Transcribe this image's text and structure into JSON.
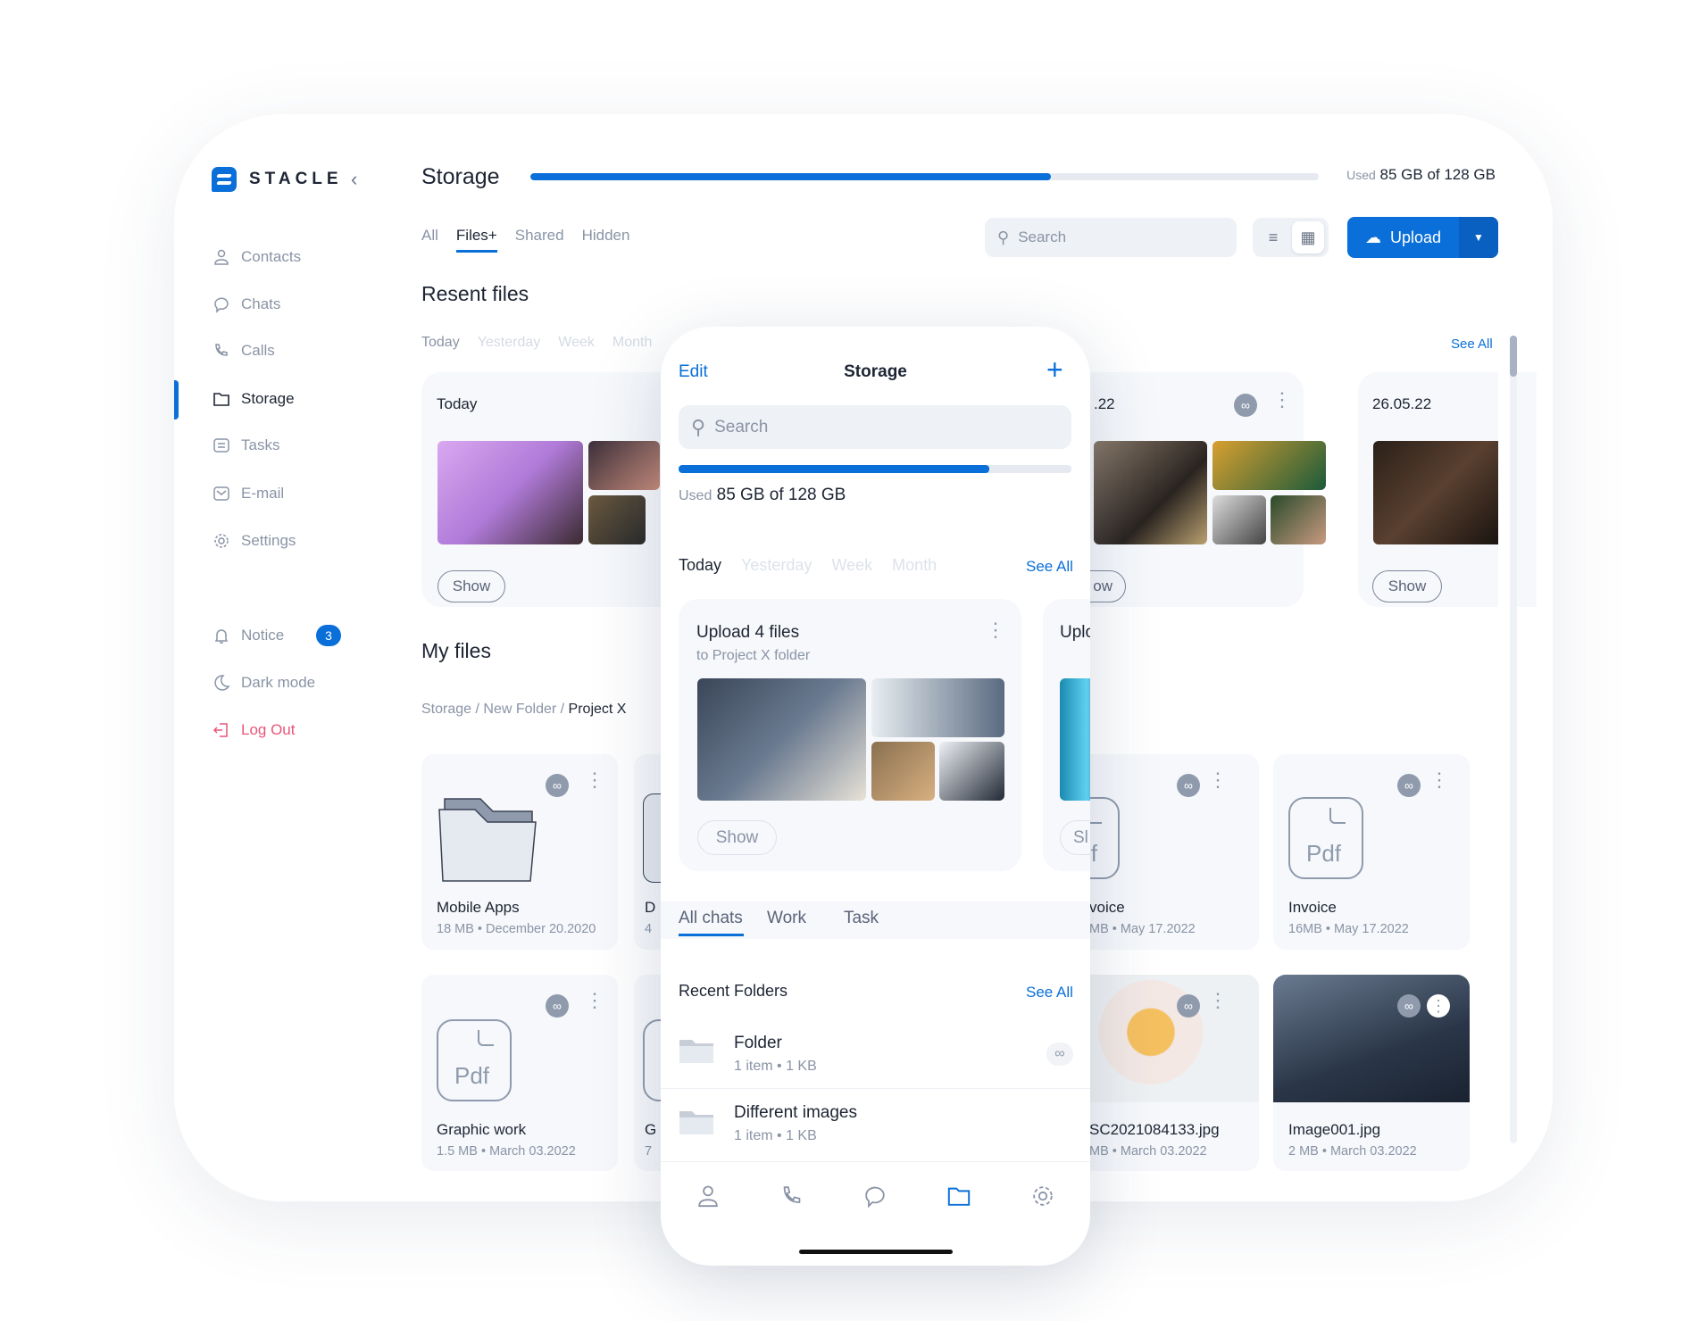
{
  "app": {
    "brand": "STACLE"
  },
  "sidebar": {
    "items": [
      {
        "label": "Contacts",
        "icon": "user-icon"
      },
      {
        "label": "Chats",
        "icon": "chat-icon"
      },
      {
        "label": "Calls",
        "icon": "phone-icon"
      },
      {
        "label": "Storage",
        "icon": "folder-cloud-icon",
        "active": true
      },
      {
        "label": "Tasks",
        "icon": "tasks-icon"
      },
      {
        "label": "E-mail",
        "icon": "mail-icon"
      },
      {
        "label": "Settings",
        "icon": "gear-icon"
      }
    ],
    "notice": {
      "label": "Notice",
      "count": "3"
    },
    "dark_mode": "Dark mode",
    "logout": "Log Out"
  },
  "header": {
    "title": "Storage",
    "used_label": "Used",
    "used_value": "85 GB of 128 GB",
    "progress_percent": 66
  },
  "tabs": [
    "All",
    "Files+",
    "Shared",
    "Hidden"
  ],
  "toolbar": {
    "search_placeholder": "Search",
    "upload": "Upload"
  },
  "recent": {
    "title": "Resent files",
    "periods": [
      "Today",
      "Yesterday",
      "Week",
      "Month"
    ],
    "see_all": "See All",
    "cards": [
      {
        "date": "Today",
        "show": "Show"
      },
      {
        "date": ".22",
        "show": "ow"
      },
      {
        "date": "26.05.22",
        "show": "Show"
      }
    ]
  },
  "myfiles": {
    "title": "My files",
    "breadcrumb": [
      "Storage",
      "New Folder",
      "Project X"
    ],
    "files": [
      {
        "name": "Mobile Apps",
        "meta": "18 MB • December 20.2020",
        "type": "folder"
      },
      {
        "name": "D",
        "meta": "4",
        "type": "folder"
      },
      {
        "name": "voice",
        "meta": "MB • May 17.2022",
        "type": "pdf"
      },
      {
        "name": "Invoice",
        "meta": "16MB • May 17.2022",
        "type": "pdf"
      },
      {
        "name": "Graphic work",
        "meta": "1.5 MB • March 03.2022",
        "type": "pdf"
      },
      {
        "name": "G",
        "meta": "7",
        "type": "pdf"
      },
      {
        "name": "SC2021084133.jpg",
        "meta": "MB • March 03.2022",
        "type": "image"
      },
      {
        "name": "Image001.jpg",
        "meta": "2 MB • March 03.2022",
        "type": "image"
      }
    ],
    "pdf_label": "Pdf"
  },
  "phone": {
    "edit": "Edit",
    "title": "Storage",
    "search_placeholder": "Search",
    "used_label": "Used",
    "used_value": "85 GB of 128 GB",
    "progress_percent": 79,
    "periods": [
      "Today",
      "Yesterday",
      "Week",
      "Month"
    ],
    "see_all": "See All",
    "upload_card": {
      "title": "Upload 4 files",
      "subtitle": "to Project X folder",
      "show": "Show"
    },
    "upload_card2": {
      "title": "Uplo",
      "show": "Sl"
    },
    "chat_tabs": [
      "All chats",
      "Work",
      "Task"
    ],
    "recent_folders": {
      "title": "Recent Folders",
      "see_all": "See All",
      "items": [
        {
          "name": "Folder",
          "meta": "1 item • 1 KB"
        },
        {
          "name": "Different images",
          "meta": "1 item • 1 KB"
        }
      ]
    },
    "bottom_nav": [
      "user-icon",
      "phone-icon",
      "chat-icon",
      "folder-cloud-icon",
      "gear-icon"
    ]
  },
  "colors": {
    "accent": "#0a6fd8",
    "logout": "#e8557a",
    "muted": "#8a94a6"
  }
}
